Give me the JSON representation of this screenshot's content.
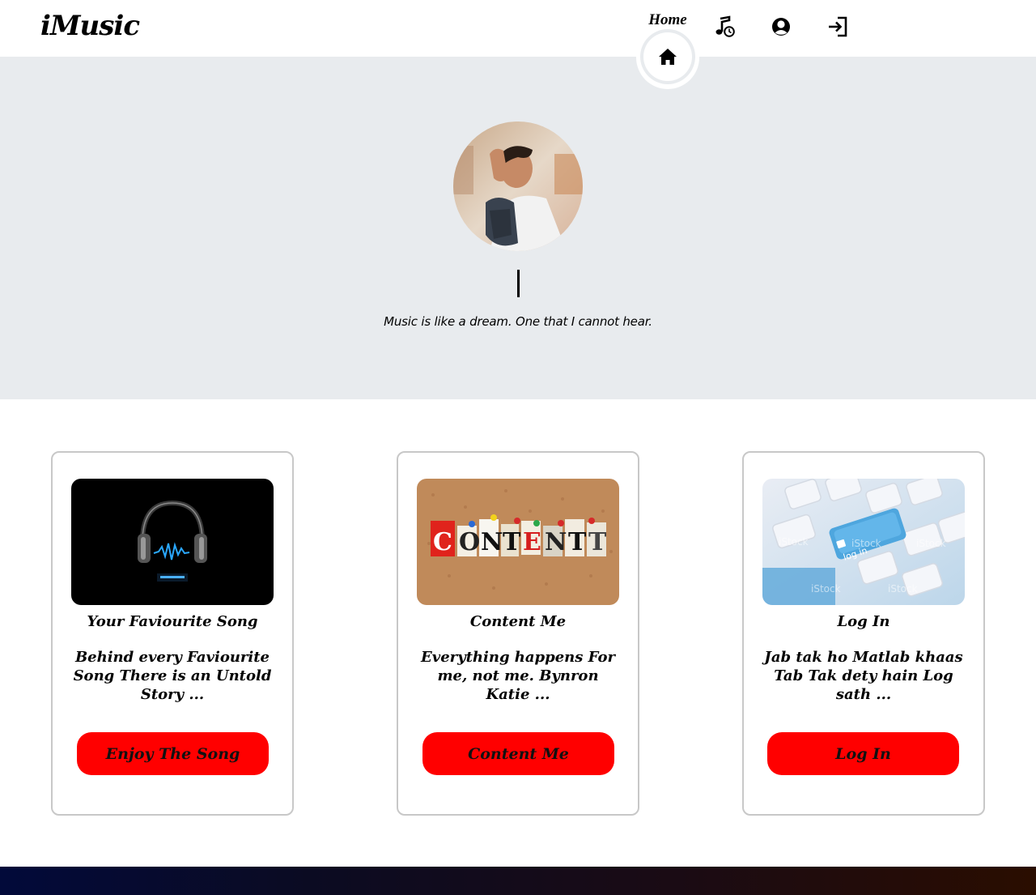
{
  "header": {
    "logo": "iMusic",
    "nav": {
      "active_label": "Home",
      "items": [
        {
          "name": "home",
          "icon": "home-icon"
        },
        {
          "name": "music",
          "icon": "music-note-clock-icon"
        },
        {
          "name": "profile",
          "icon": "user-circle-icon"
        },
        {
          "name": "login",
          "icon": "sign-in-icon"
        }
      ]
    }
  },
  "hero": {
    "avatar_alt": "profile-photo",
    "tagline": "Music is like a dream. One that I cannot hear."
  },
  "cards": [
    {
      "image": "headphones-image",
      "title": "Your Faviourite Song",
      "text": "Behind every Faviourite Song There is an Untold Story ...",
      "button": "Enjoy The Song"
    },
    {
      "image": "content-letters-image",
      "title": "Content Me",
      "text": "Everything happens For me, not me. Bynron Katie ...",
      "button": "Content Me"
    },
    {
      "image": "keyboard-login-image",
      "title": "Log In",
      "text": "Jab tak ho Matlab khaas Tab Tak dety hain Log sath ...",
      "button": "Log In"
    }
  ],
  "colors": {
    "hero_bg": "#e8ebee",
    "button_red": "#ff0000",
    "card_border": "#c8c8c8",
    "footer_start": "#020a3a",
    "footer_end": "#2a0d00"
  }
}
